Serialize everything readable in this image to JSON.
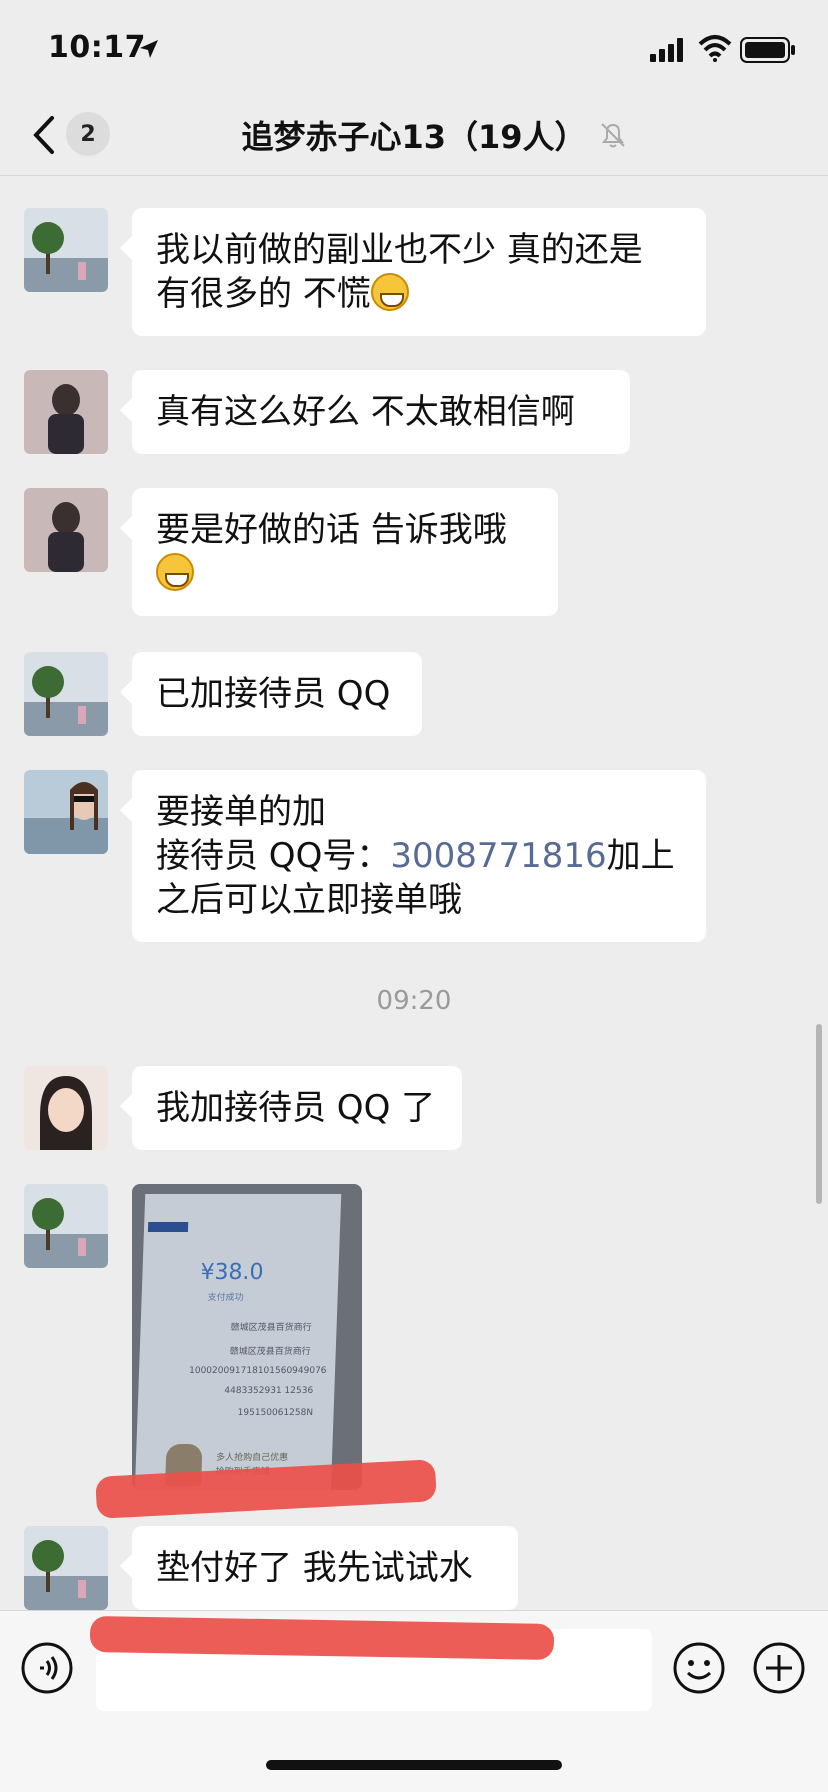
{
  "status_bar": {
    "time": "10:17",
    "icons": [
      "location-arrow-icon",
      "cellular-signal-icon",
      "wifi-icon",
      "battery-icon"
    ]
  },
  "header": {
    "unread_count": "2",
    "title": "追梦赤子心13（19人）",
    "icons": [
      "back-chevron-icon",
      "mute-bell-icon"
    ]
  },
  "messages": [
    {
      "avatar": "tree-lake-avatar",
      "text": "我以前做的副业也不少 真的还是\n有很多的 不慌",
      "emoji": "grinning-face-emoji"
    },
    {
      "avatar": "person-dark-avatar",
      "text": "真有这么好么 不太敢相信啊"
    },
    {
      "avatar": "person-dark-avatar",
      "text": "要是好做的话 告诉我哦",
      "emoji": "grinning-face-emoji"
    },
    {
      "avatar": "tree-lake-avatar",
      "text": "已加接待员 QQ"
    },
    {
      "avatar": "sunglasses-woman-avatar",
      "line1": "要接单的加",
      "line2_prefix": "接待员 QQ号：",
      "qq_number": "3008771816",
      "line2_suffix": "加上",
      "line3": "之后可以立即接单哦"
    },
    {
      "avatar": "woman-portrait-avatar",
      "text": "我加接待员 QQ 了"
    },
    {
      "avatar": "tree-lake-avatar",
      "type": "image",
      "image": {
        "amount": "¥38.0",
        "paid_label": "支付成功",
        "merchant": "赣城区茂县百货商行",
        "rows": [
          "赣城区茂县百货商行",
          "100020091718101560949076",
          "4483352931 12536",
          "195150061258N"
        ],
        "ad_text_1": "多人抢购自己优惠",
        "ad_text_2": "抢购到手店铺"
      }
    },
    {
      "avatar": "tree-lake-avatar",
      "text": "垫付好了 我先试试水"
    }
  ],
  "timestamp": "09:20",
  "input_bar": {
    "placeholder": "",
    "icons": [
      "voice-icon",
      "emoji-icon",
      "plus-icon"
    ]
  },
  "colors": {
    "background": "#ededed",
    "bubble": "#ffffff",
    "link": "#576b95",
    "redaction": "#ec4f4a"
  }
}
